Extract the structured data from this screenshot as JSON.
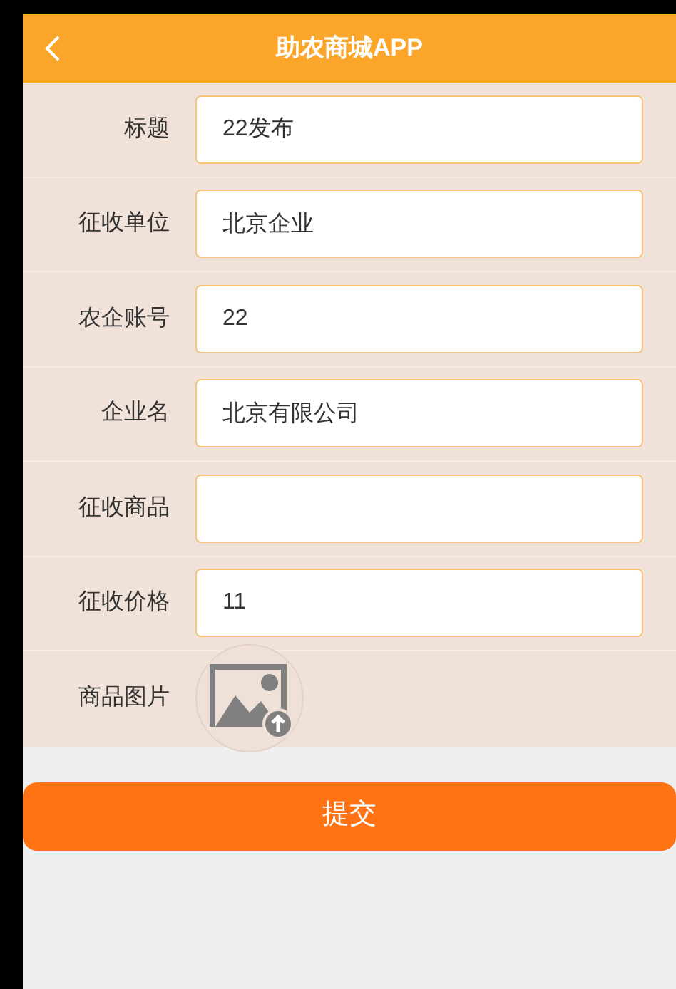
{
  "header": {
    "title": "助农商城APP"
  },
  "fields": [
    {
      "kind": "text",
      "label": "标题",
      "value": "22发布"
    },
    {
      "kind": "text",
      "label": "征收单位",
      "value": "北京企业"
    },
    {
      "kind": "text",
      "label": "农企账号",
      "value": "22"
    },
    {
      "kind": "text",
      "label": "企业名",
      "value": "北京有限公司"
    },
    {
      "kind": "text",
      "label": "征收商品"
    },
    {
      "kind": "text",
      "label": "征收价格",
      "value": "11"
    },
    {
      "kind": "image",
      "label": "商品图片"
    }
  ],
  "submit": {
    "label": "提交"
  }
}
